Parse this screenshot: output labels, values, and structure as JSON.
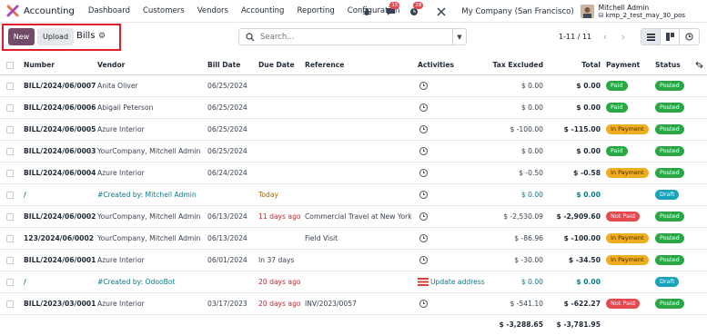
{
  "app": {
    "name": "Accounting"
  },
  "menu": [
    "Dashboard",
    "Customers",
    "Vendors",
    "Accounting",
    "Reporting",
    "Configuration"
  ],
  "navbar": {
    "chat_count": "15",
    "activity_count": "28",
    "company": "My Company (San Francisco)",
    "user_name": "Mitchell Admin",
    "database": "kmp_2_test_may_30_pos"
  },
  "control_panel": {
    "new_label": "New",
    "upload_label": "Upload",
    "title": "Bills",
    "search_placeholder": "Search...",
    "pager": "1-11 / 11"
  },
  "columns": {
    "number": "Number",
    "vendor": "Vendor",
    "bill_date": "Bill Date",
    "due_date": "Due Date",
    "reference": "Reference",
    "activities": "Activities",
    "tax_excluded": "Tax Excluded",
    "total": "Total",
    "payment": "Payment",
    "status": "Status"
  },
  "rows": [
    {
      "number": "BILL/2024/06/0007",
      "vendor": "Anita Oliver",
      "bill_date": "06/25/2024",
      "due_date": "",
      "due_style": "",
      "reference": "",
      "activity": "clock",
      "activity_text": "",
      "tax_excluded": "$ 0.00",
      "total": "$ 0.00",
      "payment": "Paid",
      "status": "Posted",
      "draft": false
    },
    {
      "number": "BILL/2024/06/0006",
      "vendor": "Abigail Peterson",
      "bill_date": "06/25/2024",
      "due_date": "",
      "due_style": "",
      "reference": "",
      "activity": "clock",
      "activity_text": "",
      "tax_excluded": "$ 0.00",
      "total": "$ 0.00",
      "payment": "Paid",
      "status": "Posted",
      "draft": false
    },
    {
      "number": "BILL/2024/06/0005",
      "vendor": "Azure Interior",
      "bill_date": "06/25/2024",
      "due_date": "",
      "due_style": "",
      "reference": "",
      "activity": "clock",
      "activity_text": "",
      "tax_excluded": "$ -100.00",
      "total": "$ -115.00",
      "payment": "In Payment",
      "status": "Posted",
      "draft": false
    },
    {
      "number": "BILL/2024/06/0003",
      "vendor": "YourCompany, Mitchell Admin",
      "bill_date": "06/25/2024",
      "due_date": "",
      "due_style": "",
      "reference": "",
      "activity": "clock",
      "activity_text": "",
      "tax_excluded": "$ 0.00",
      "total": "$ 0.00",
      "payment": "Paid",
      "status": "Posted",
      "draft": false
    },
    {
      "number": "BILL/2024/06/0004",
      "vendor": "Azure Interior",
      "bill_date": "06/24/2024",
      "due_date": "",
      "due_style": "",
      "reference": "",
      "activity": "clock",
      "activity_text": "",
      "tax_excluded": "$ -0.50",
      "total": "$ -0.58",
      "payment": "In Payment",
      "status": "Posted",
      "draft": false
    },
    {
      "number": "/",
      "vendor": "#Created by: Mitchell Admin",
      "bill_date": "",
      "due_date": "Today",
      "due_style": "amber",
      "reference": "",
      "activity": "clock",
      "activity_text": "",
      "tax_excluded": "$ 0.00",
      "total": "$ 0.00",
      "payment": "",
      "status": "Draft",
      "draft": true
    },
    {
      "number": "BILL/2024/06/0002",
      "vendor": "YourCompany, Mitchell Admin",
      "bill_date": "06/13/2024",
      "due_date": "11 days ago",
      "due_style": "red",
      "reference": "Commercial Travel at New York",
      "activity": "clock",
      "activity_text": "",
      "tax_excluded": "$ -2,530.09",
      "total": "$ -2,909.60",
      "payment": "Not Paid",
      "status": "Posted",
      "draft": false
    },
    {
      "number": "123/2024/06/0002",
      "vendor": "YourCompany, Mitchell Admin",
      "bill_date": "06/13/2024",
      "due_date": "",
      "due_style": "",
      "reference": "Field Visit",
      "activity": "clock",
      "activity_text": "",
      "tax_excluded": "$ -86.96",
      "total": "$ -100.00",
      "payment": "In Payment",
      "status": "Posted",
      "draft": false
    },
    {
      "number": "BILL/2024/06/0001",
      "vendor": "Azure Interior",
      "bill_date": "06/01/2024",
      "due_date": "In 37 days",
      "due_style": "",
      "reference": "",
      "activity": "clock",
      "activity_text": "",
      "tax_excluded": "$ -30.00",
      "total": "$ -34.50",
      "payment": "In Payment",
      "status": "Posted",
      "draft": false
    },
    {
      "number": "/",
      "vendor": "#Created by: OdooBot",
      "bill_date": "",
      "due_date": "20 days ago",
      "due_style": "red",
      "reference": "",
      "activity": "list",
      "activity_text": "Update address",
      "tax_excluded": "$ 0.00",
      "total": "$ 0.00",
      "payment": "",
      "status": "Draft",
      "draft": true
    },
    {
      "number": "BILL/2023/03/0001",
      "vendor": "Azure Interior",
      "bill_date": "03/17/2023",
      "due_date": "20 days ago",
      "due_style": "red",
      "reference": "INV/2023/0057",
      "activity": "clock",
      "activity_text": "",
      "tax_excluded": "$ -541.10",
      "total": "$ -622.27",
      "payment": "Not Paid",
      "status": "Posted",
      "draft": false
    }
  ],
  "totals": {
    "tax_excluded": "$ -3,288.65",
    "total": "$ -3,781.95"
  },
  "colors": {
    "primary": "#714b67",
    "posted": "#28a745",
    "paid": "#28a745",
    "in_payment": "#f0ad1e",
    "not_paid": "#e5484d",
    "draft": "#17a2b8",
    "highlight": "#e11d2a"
  }
}
